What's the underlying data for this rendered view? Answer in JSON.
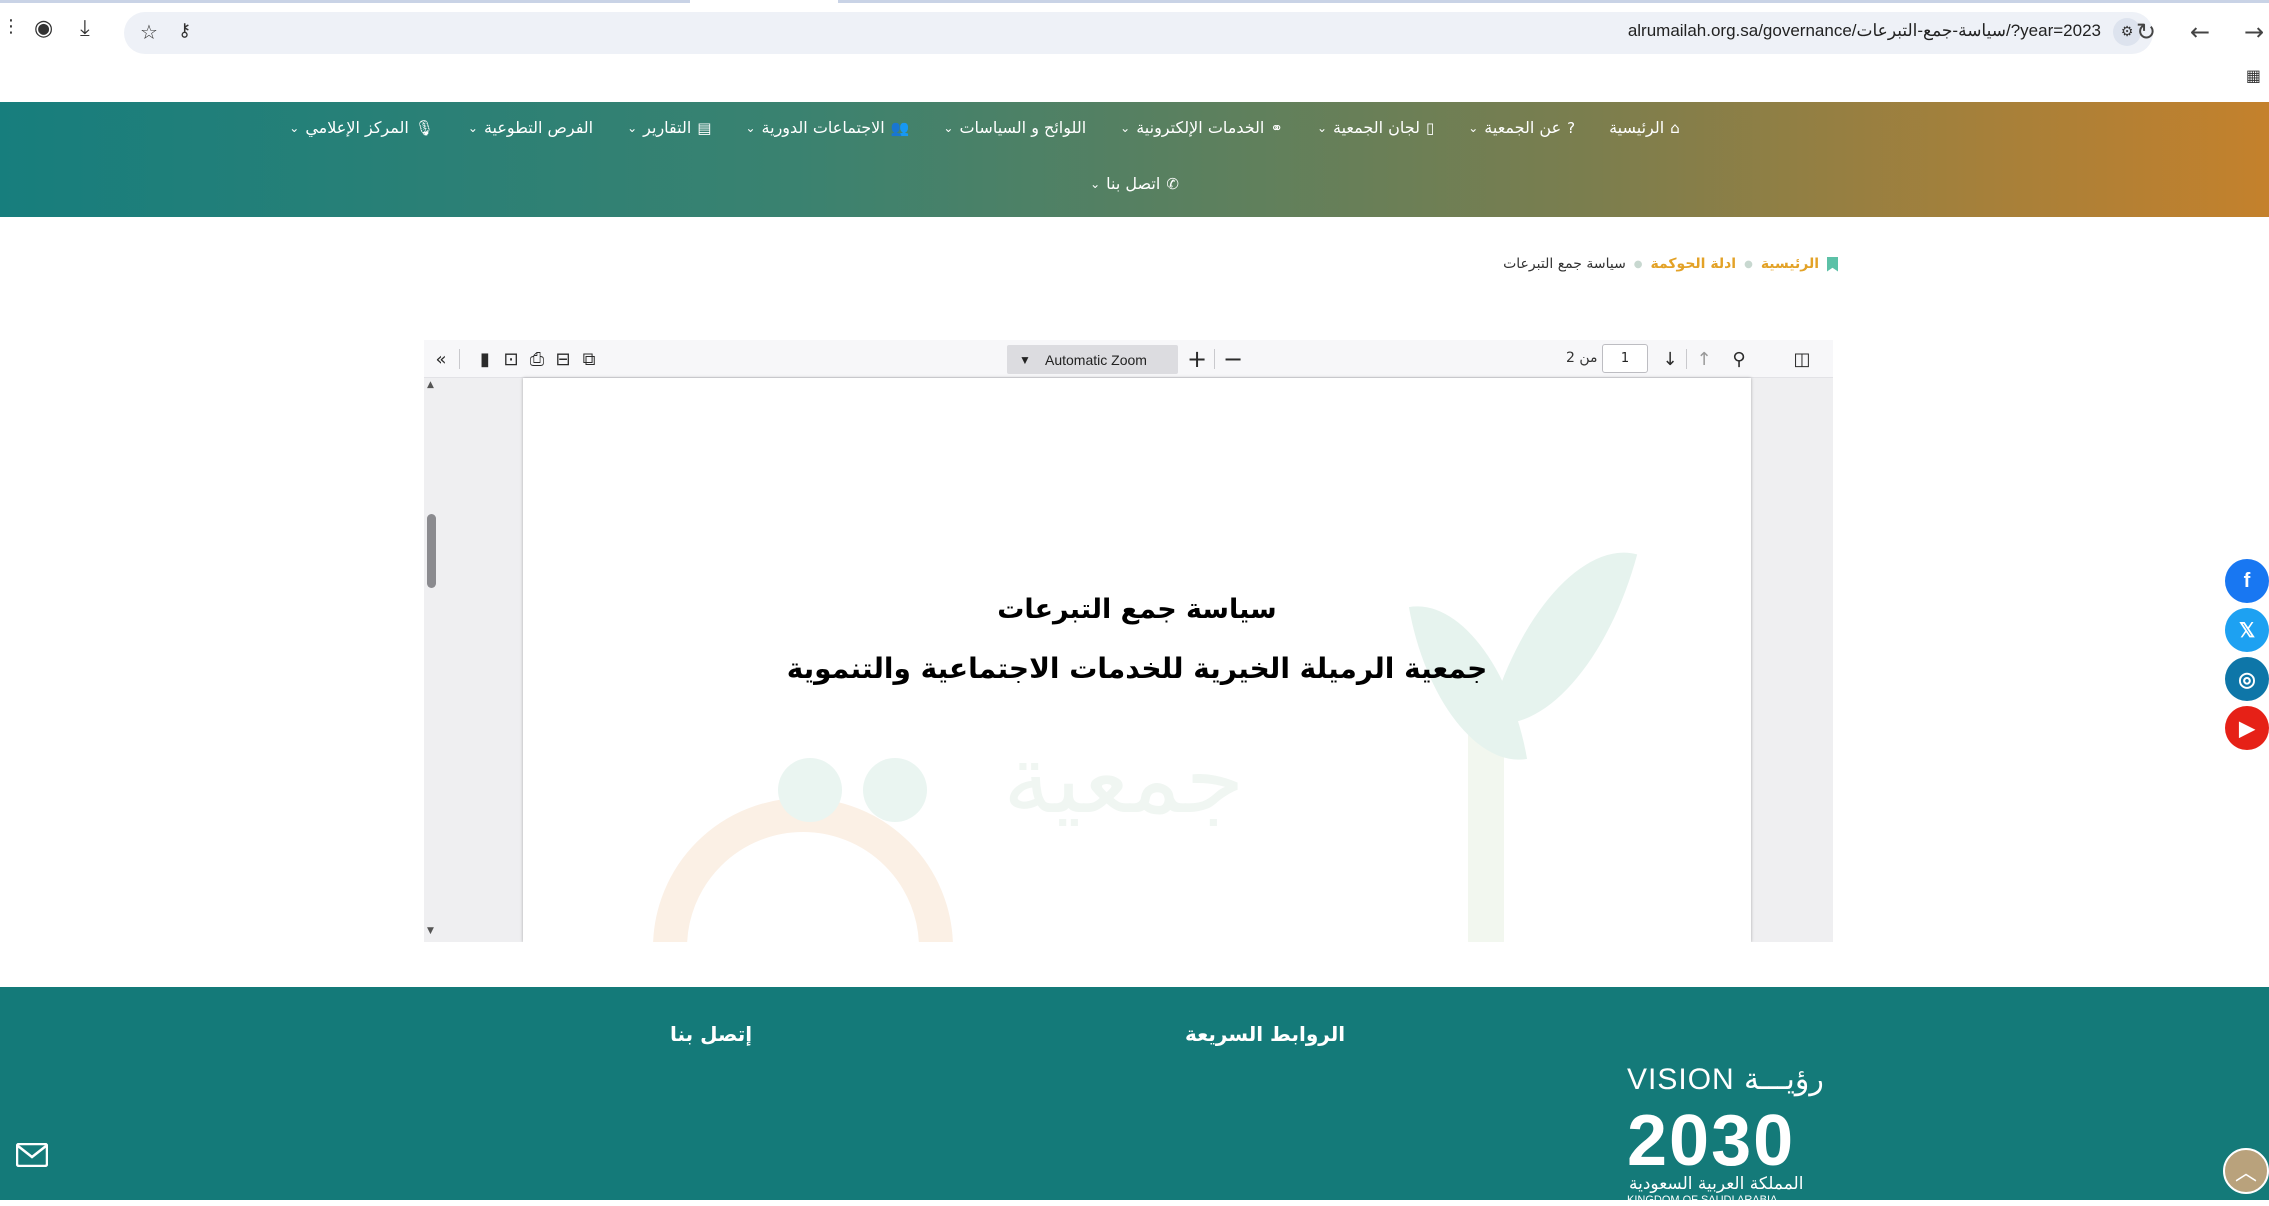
{
  "browser": {
    "url": "alrumailah.org.sa/governance/سياسة-جمع-التبرعات/?year=2023"
  },
  "nav": {
    "row1": [
      {
        "label": "الرئيسية",
        "icon": "home-icon",
        "glyph": "⌂",
        "caret": false
      },
      {
        "label": "عن الجمعية",
        "icon": "question-icon",
        "glyph": "?",
        "caret": true
      },
      {
        "label": "لجان الجمعية",
        "icon": "document-icon",
        "glyph": "▯",
        "caret": true
      },
      {
        "label": "الخدمات الإلكترونية",
        "icon": "link-icon",
        "glyph": "⚭",
        "caret": true
      },
      {
        "label": "اللوائح و السياسات",
        "icon": "",
        "glyph": "",
        "caret": true
      },
      {
        "label": "الاجتماعات الدورية",
        "icon": "users-icon",
        "glyph": "👥",
        "caret": true
      },
      {
        "label": "التقارير",
        "icon": "report-icon",
        "glyph": "▤",
        "caret": true
      },
      {
        "label": "الفرص التطوعية",
        "icon": "",
        "glyph": "",
        "caret": true
      },
      {
        "label": "المركز الإعلامي",
        "icon": "microphone-icon",
        "glyph": "🎙",
        "caret": true
      }
    ],
    "row2": [
      {
        "label": "اتصل بنا",
        "icon": "phone-icon",
        "glyph": "✆",
        "caret": true
      }
    ]
  },
  "breadcrumb": {
    "home": "الرئيسية",
    "section": "ادلة الحوكمة",
    "current": "سياسة جمع التبرعات"
  },
  "pdf": {
    "zoom": "Automatic Zoom",
    "page_current": "1",
    "page_total_label": "من 2",
    "doc_title": "سياسة جمع التبرعات",
    "doc_subtitle": "جمعية الرميلة الخيرية للخدمات الاجتماعية والتنموية",
    "watermark_text": "جمعية"
  },
  "social": [
    {
      "name": "facebook",
      "glyph": "f",
      "color": "#1877f2"
    },
    {
      "name": "x",
      "glyph": "𝕏",
      "color": "#1da1f2"
    },
    {
      "name": "instagram",
      "glyph": "◎",
      "color": "#0e76a8"
    },
    {
      "name": "youtube",
      "glyph": "▶",
      "color": "#e62117"
    }
  ],
  "footer": {
    "quick_links": "الروابط السريعة",
    "contact": "إتصل بنا",
    "vision_line1": "VISION رؤيـــة",
    "vision_year": "2030",
    "vision_ar": "المملكة العربية السعودية",
    "vision_en": "KINGDOM OF SAUDI ARABIA"
  }
}
